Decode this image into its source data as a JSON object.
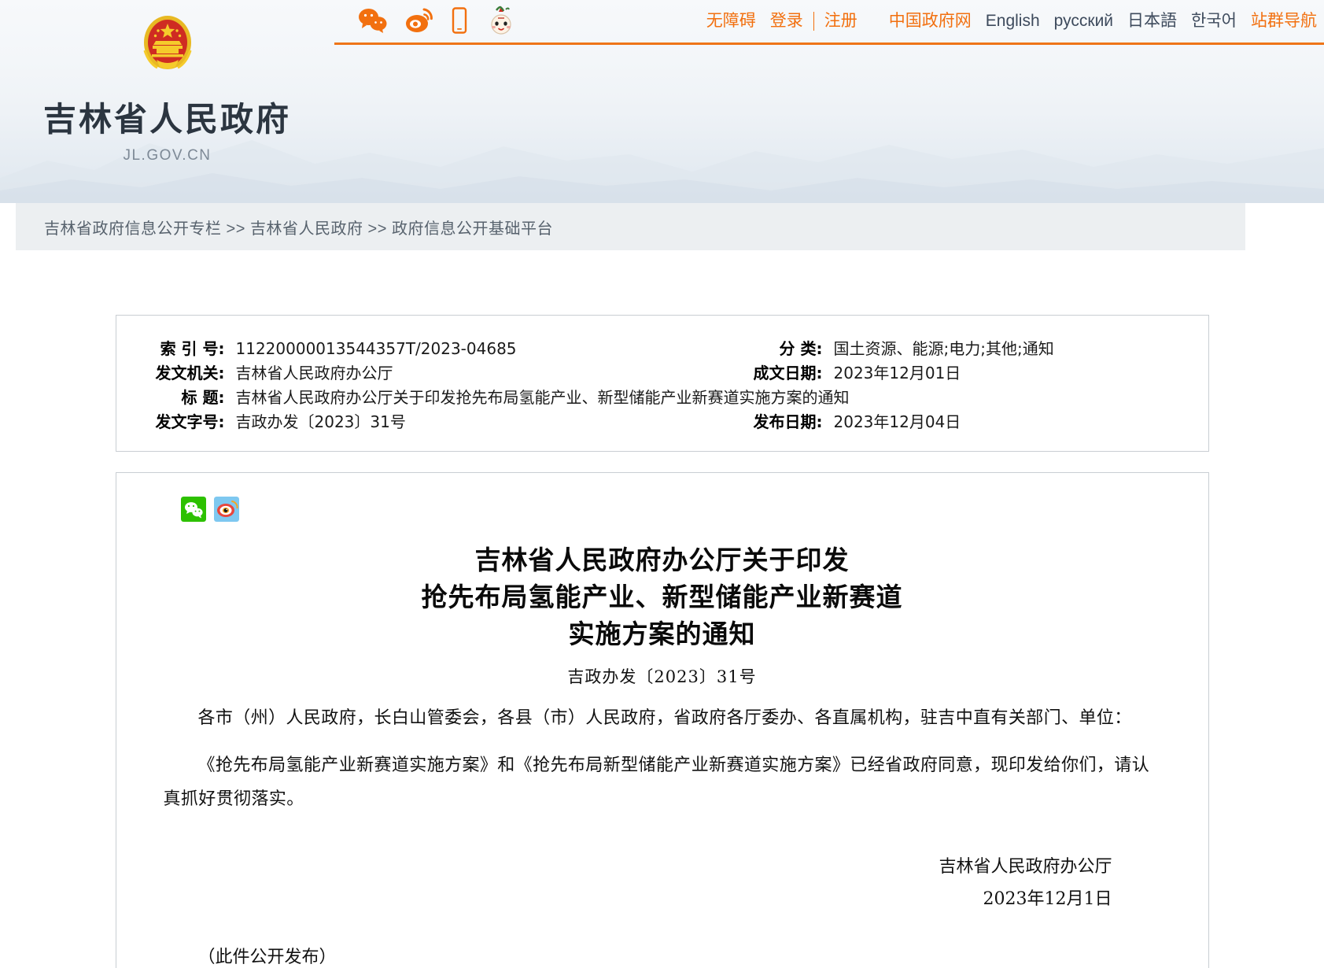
{
  "header": {
    "site_title": "吉林省人民政府",
    "site_url": "JL.GOV.CN",
    "emblem_alt": "national-emblem",
    "social": [
      {
        "name": "wechat-icon",
        "label": "微信"
      },
      {
        "name": "weibo-icon",
        "label": "微博"
      },
      {
        "name": "mobile-icon",
        "label": "手机版"
      },
      {
        "name": "mascot-icon",
        "label": "吉祥物"
      }
    ],
    "nav": [
      {
        "label": "无障碍",
        "accent": true
      },
      {
        "label": "登录",
        "accent": true
      },
      {
        "label": "注册",
        "accent": true
      },
      {
        "label": "中国政府网",
        "accent": true
      },
      {
        "label": "English",
        "accent": false
      },
      {
        "label": "русский",
        "accent": false
      },
      {
        "label": "日本語",
        "accent": false
      },
      {
        "label": "한국어",
        "accent": false
      },
      {
        "label": "站群导航",
        "accent": true
      }
    ],
    "accent_color": "#ee7518",
    "link_color": "#3d4a5c"
  },
  "breadcrumb": {
    "text": "吉林省政府信息公开专栏 >> 吉林省人民政府 >> 政府信息公开基础平台"
  },
  "meta": {
    "rows": [
      {
        "left_label": "索 引 号:",
        "left_value": "11220000013544357T/2023-04685",
        "right_label": "分 类:",
        "right_value": "国土资源、能源;电力;其他;通知"
      },
      {
        "left_label": "发文机关:",
        "left_value": "吉林省人民政府办公厅",
        "right_label": "成文日期:",
        "right_value": "2023年12月01日"
      },
      {
        "left_label": "标 题:",
        "left_value": "吉林省人民政府办公厅关于印发抢先布局氢能产业、新型储能产业新赛道实施方案的通知",
        "right_label": "",
        "right_value": ""
      },
      {
        "left_label": "发文字号:",
        "left_value": "吉政办发〔2023〕31号",
        "right_label": "发布日期:",
        "right_value": "2023年12月04日"
      }
    ]
  },
  "article": {
    "share": [
      {
        "name": "wechat-share-icon",
        "label": "分享到微信"
      },
      {
        "name": "weibo-share-icon",
        "label": "分享到微博"
      }
    ],
    "title_lines": [
      "吉林省人民政府办公厅关于印发",
      "抢先布局氢能产业、新型储能产业新赛道",
      "实施方案的通知"
    ],
    "doc_number": "吉政办发〔2023〕31号",
    "salutation": "各市（州）人民政府，长白山管委会，各县（市）人民政府，省政府各厅委办、各直属机构，驻吉中直有关部门、单位：",
    "body": "《抢先布局氢能产业新赛道实施方案》和《抢先布局新型储能产业新赛道实施方案》已经省政府同意，现印发给你们，请认真抓好贯彻落实。",
    "signer": "吉林省人民政府办公厅",
    "sign_date": "2023年12月1日",
    "note": "（此件公开发布）"
  }
}
